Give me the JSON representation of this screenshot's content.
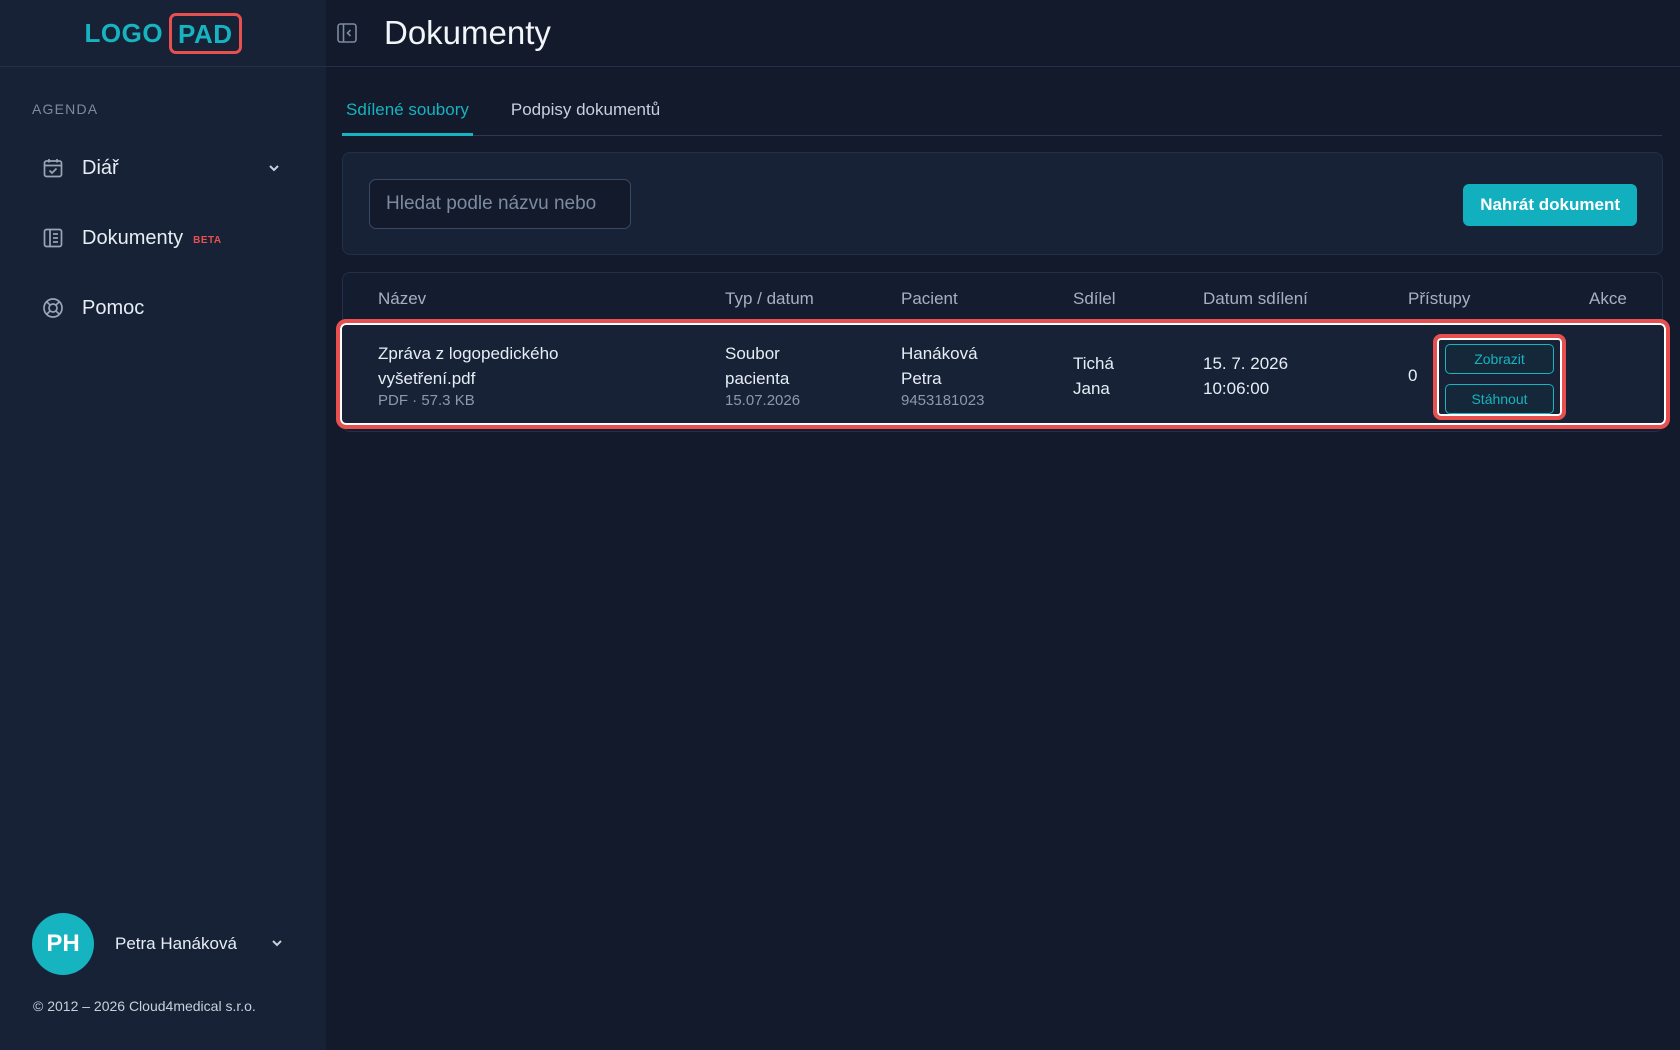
{
  "logo": {
    "part1": "LOGO",
    "part2": "PAD"
  },
  "sidebar": {
    "section_label": "AGENDA",
    "items": [
      {
        "label": "Diář",
        "icon": "calendar-check-icon"
      },
      {
        "label": "Dokumenty",
        "icon": "document-icon",
        "badge": "BETA"
      },
      {
        "label": "Pomoc",
        "icon": "lifebuoy-icon"
      }
    ],
    "user": {
      "initials": "PH",
      "name": "Petra Hanáková"
    },
    "copyright": "© 2012 – 2026 Cloud4medical s.r.o."
  },
  "header": {
    "title": "Dokumenty"
  },
  "tabs": [
    {
      "label": "Sdílené soubory",
      "active": true
    },
    {
      "label": "Podpisy dokumentů",
      "active": false
    }
  ],
  "toolbar": {
    "search_placeholder": "Hledat podle názvu nebo",
    "upload_label": "Nahrát dokument"
  },
  "table": {
    "headers": [
      "Název",
      "Typ / datum",
      "Pacient",
      "Sdílel",
      "Datum sdílení",
      "Přístupy",
      "Akce"
    ],
    "rows": [
      {
        "name_line1": "Zpráva z logopedického",
        "name_line2": "vyšetření.pdf",
        "file_meta": "PDF · 57.3 KB",
        "type_line1": "Soubor",
        "type_line2": "pacienta",
        "type_date": "15.07.2026",
        "patient_line1": "Hanáková",
        "patient_line2": "Petra",
        "patient_id": "9453181023",
        "shared_by_line1": "Tichá",
        "shared_by_line2": "Jana",
        "shared_date": "15. 7. 2026",
        "shared_time": "10:06:00",
        "accesses": "0",
        "view_label": "Zobrazit",
        "download_label": "Stáhnout"
      }
    ]
  },
  "colors": {
    "accent": "#16b3c0",
    "highlight": "#e8504f",
    "background": "#121a2b",
    "sidebar": "#172236"
  }
}
